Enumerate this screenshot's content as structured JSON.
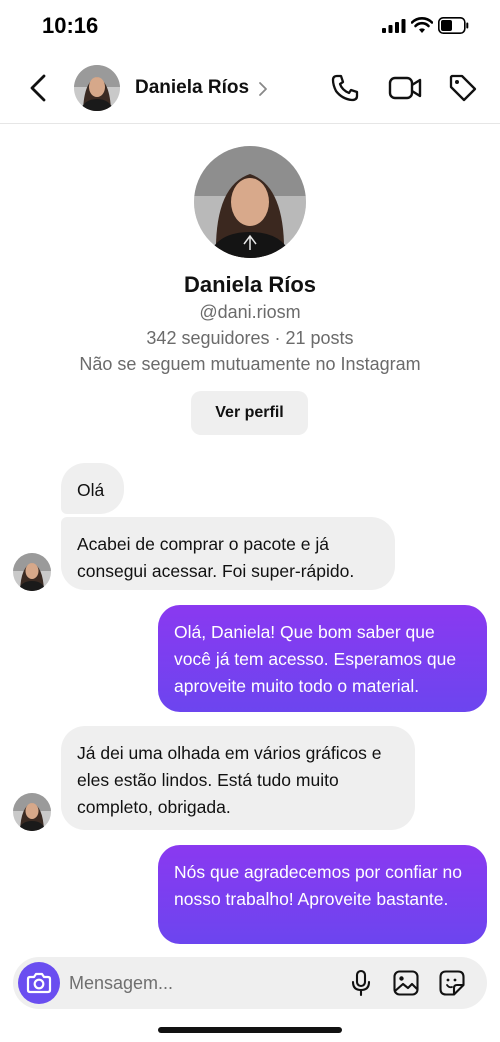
{
  "status_bar": {
    "time": "10:16"
  },
  "header": {
    "name": "Daniela Ríos"
  },
  "profile": {
    "name": "Daniela Ríos",
    "handle": "@dani.riosm",
    "stats": "342 seguidores · 21 posts",
    "mutual": "Não se seguem mutuamente no Instagram",
    "view_profile_label": "Ver perfil"
  },
  "messages": [
    {
      "from": "them",
      "text": "Olá"
    },
    {
      "from": "them",
      "text": "Acabei de comprar o pacote e já consegui acessar. Foi super-rápido."
    },
    {
      "from": "me",
      "text": "Olá, Daniela! Que bom saber que você já tem acesso. Esperamos que aproveite muito todo o material."
    },
    {
      "from": "them",
      "text": "Já dei uma olhada em vários gráficos e eles estão lindos. Está tudo muito completo, obrigada."
    },
    {
      "from": "me",
      "text": "Nós que agradecemos por confiar no nosso trabalho! Aproveite bastante."
    }
  ],
  "composer": {
    "placeholder": "Mensagem..."
  },
  "colors": {
    "outgoing_top": "#8a39f0",
    "outgoing_bottom": "#6c45ef",
    "incoming": "#efefef",
    "camera": "#6a4ef0"
  },
  "icons": [
    "back-icon",
    "phone-icon",
    "video-camera-icon",
    "tag-icon",
    "camera-icon",
    "microphone-icon",
    "gallery-icon",
    "sticker-icon"
  ]
}
